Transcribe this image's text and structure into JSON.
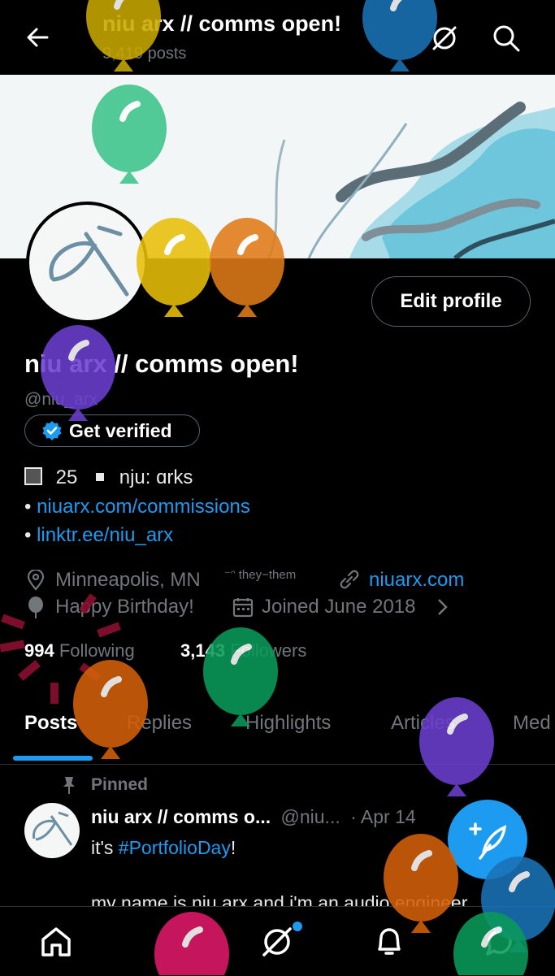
{
  "header": {
    "title": "niu arx // comms open!",
    "posts_count": "9,419 posts"
  },
  "profile": {
    "display_name": "niu arx // comms open!",
    "handle": "@niu_arx",
    "edit_label": "Edit profile",
    "verify_label": "Get verified",
    "bio_line1_age": "25",
    "bio_line1_name": "nju: ɑrks",
    "bio_link1": "niuarx.com/commissions",
    "bio_link2": "linktr.ee/niu_arx",
    "bullet": "•",
    "location": "Minneapolis, MN",
    "pronouns": "⁻ᵔ they−them",
    "website": "niuarx.com",
    "birthday": "Happy Birthday!",
    "joined": "Joined June 2018",
    "following_count": "994",
    "following_label": "Following",
    "followers_count": "3,143",
    "followers_label": "Followers"
  },
  "tabs": [
    "Posts",
    "Replies",
    "Highlights",
    "Articles",
    "Med"
  ],
  "post": {
    "pinned_label": "Pinned",
    "author": "niu arx // comms o...",
    "handle": "@niu...",
    "date": "· Apr 14",
    "more": "·",
    "text_prefix": "it's ",
    "hashtag": "#PortfolioDay",
    "text_suffix": "!",
    "text_line2": "my name is niu arx and i'm an audio engineer"
  },
  "icons": {
    "back": "arrow-left-icon",
    "grok": "grok-icon",
    "search": "search-icon",
    "verified": "verified-badge-icon",
    "location": "location-pin-icon",
    "link": "link-icon",
    "balloon": "balloon-icon",
    "calendar": "calendar-icon",
    "chevron": "chevron-right-icon",
    "pin": "pin-icon",
    "compose": "compose-post-icon",
    "home": "home-icon",
    "notifications": "bell-icon",
    "messages": "message-icon"
  },
  "colors": {
    "accent": "#1d9bf0",
    "background": "#000000",
    "muted": "#71767b",
    "balloons": [
      "#c9a800",
      "#1a73b8",
      "#3cc48a",
      "#e8c00a",
      "#e07b18",
      "#6a3fd0",
      "#0a9a5a",
      "#d4600a",
      "#6a3fd0",
      "#d4600a",
      "#1a73b8",
      "#0a9a5a",
      "#e0186a"
    ]
  }
}
